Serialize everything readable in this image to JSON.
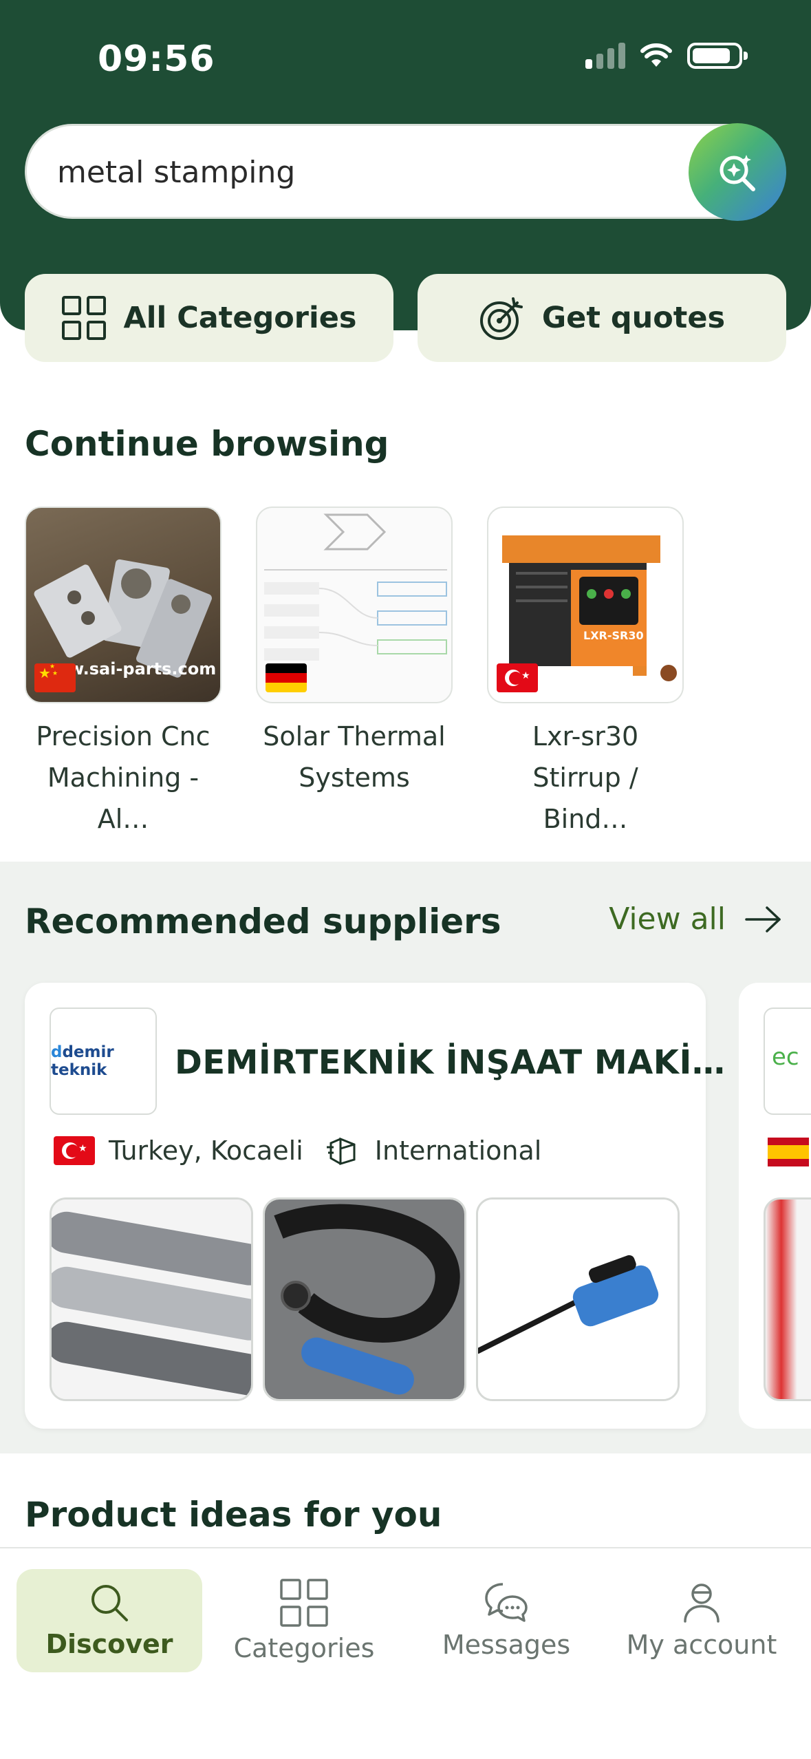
{
  "status": {
    "time": "09:56"
  },
  "search": {
    "query": "metal stamping"
  },
  "quick_actions": {
    "all_categories": "All Categories",
    "get_quotes": "Get quotes"
  },
  "continue_browsing": {
    "title": "Continue browsing",
    "items": [
      {
        "title": "Precision Cnc\nMachining - Al…",
        "watermark": "w.sai-parts.com",
        "flag": "china"
      },
      {
        "title": "Solar Thermal\nSystems",
        "flag": "germany"
      },
      {
        "title": "Lxr-sr30\nStirrup / Bind…",
        "machine_label": "LXR-SR30",
        "flag": "turkey"
      }
    ]
  },
  "recommended": {
    "title": "Recommended suppliers",
    "view_all": "View all",
    "supplier": {
      "name": "DEMİRTEKNİK İNŞAAT MAKİ…",
      "logo_text": "demir teknik",
      "location": "Turkey, Kocaeli",
      "shipping": "International"
    },
    "next_logo_text": "ec"
  },
  "product_ideas": {
    "title": "Product ideas for you"
  },
  "nav": {
    "items": [
      {
        "label": "Discover"
      },
      {
        "label": "Categories"
      },
      {
        "label": "Messages"
      },
      {
        "label": "My account"
      }
    ]
  },
  "colors": {
    "header": "#1e4d35",
    "accent": "#3d6a22",
    "pill": "#eef2e4",
    "active_nav": "#e7f0d3"
  }
}
